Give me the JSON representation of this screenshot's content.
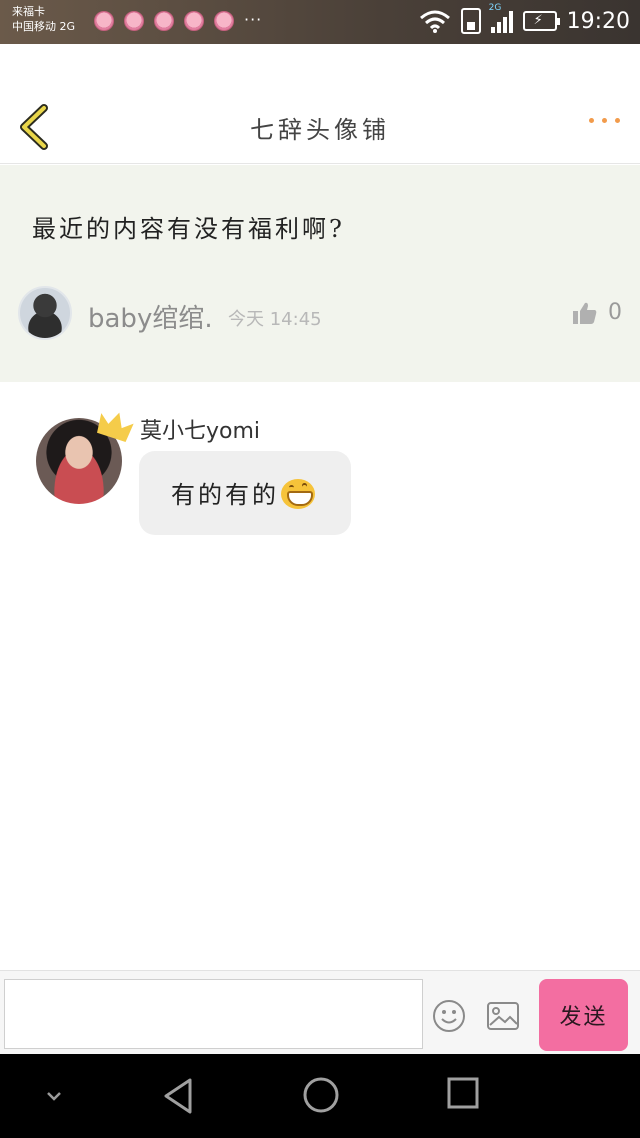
{
  "status_bar": {
    "carrier_line1": "来福卡",
    "carrier_line2": "中国移动",
    "network_label": "2G",
    "notification_icons": [
      "pig-icon",
      "pig-icon",
      "pig-icon",
      "pig-icon",
      "pig-icon"
    ],
    "more_notifications": "···",
    "signal_tag": "2G",
    "time": "19:20"
  },
  "header": {
    "title": "七辞头像铺",
    "back_icon": "chevron-left-icon",
    "more_icon": "more-horizontal-icon",
    "accent_color": "#f29b4b"
  },
  "post": {
    "text": "最近的内容有没有福利啊?",
    "author": "baby绾绾.",
    "time": "今天 14:45",
    "like_count": "0",
    "background": "#f2f4ed"
  },
  "reply": {
    "author": "莫小七yomi",
    "badge_icon": "crown-icon",
    "text": "有的有的"
  },
  "composer": {
    "input_value": "",
    "input_placeholder": "",
    "emoji_icon": "smiley-icon",
    "image_icon": "image-icon",
    "send_label": "发送",
    "send_color": "#f36ea1"
  },
  "nav_bar": {
    "icons": [
      "chevron-down-icon",
      "back-triangle-icon",
      "home-circle-icon",
      "recents-square-icon"
    ]
  }
}
